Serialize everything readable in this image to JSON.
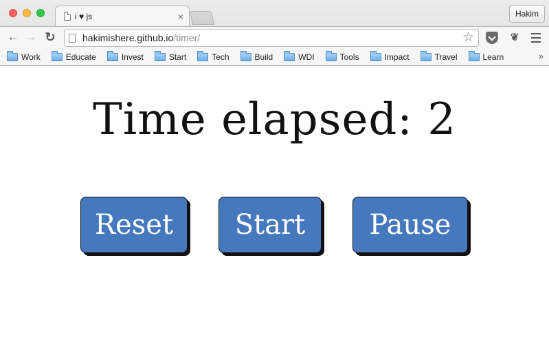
{
  "browser": {
    "tab_title": "i ♥ js",
    "tab_close": "×",
    "profile_name": "Hakim",
    "url_host": "hakimishere.github.io",
    "url_path": "/timer/",
    "nav": {
      "back": "←",
      "forward": "→",
      "reload": "↻"
    },
    "star": "☆",
    "evernote": "❦",
    "bookmarks_more": "»"
  },
  "bookmarks": [
    "Work",
    "Educate",
    "Invest",
    "Start",
    "Tech",
    "Build",
    "WDI",
    "Tools",
    "Impact",
    "Travel",
    "Learn"
  ],
  "page": {
    "heading": "Time elapsed: 2",
    "buttons": {
      "reset": "Reset",
      "start": "Start",
      "pause": "Pause"
    },
    "button_color": "#4678bd"
  }
}
